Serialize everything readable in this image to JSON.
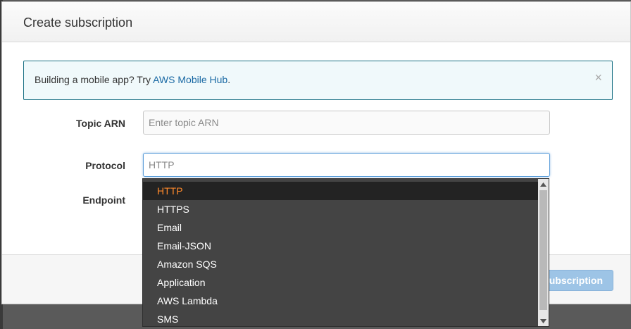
{
  "modal": {
    "title": "Create subscription",
    "alert": {
      "prefix": "Building a mobile app? Try ",
      "link": "AWS Mobile Hub",
      "suffix": ".",
      "close": "×"
    },
    "fields": {
      "topic_arn": {
        "label": "Topic ARN",
        "placeholder": "Enter topic ARN"
      },
      "protocol": {
        "label": "Protocol",
        "placeholder": "HTTP"
      },
      "endpoint": {
        "label": "Endpoint"
      }
    },
    "footer": {
      "primary_label": "subscription"
    }
  },
  "dropdown": {
    "selected": "HTTP",
    "options": [
      "HTTP",
      "HTTPS",
      "Email",
      "Email-JSON",
      "Amazon SQS",
      "Application",
      "AWS Lambda",
      "SMS"
    ]
  },
  "colors": {
    "accent_selected": "#ff8a2b",
    "link": "#1a69a4",
    "alert_border": "#1d7386",
    "dropdown_bg": "#444444",
    "primary_button": "#9dc4e6"
  }
}
